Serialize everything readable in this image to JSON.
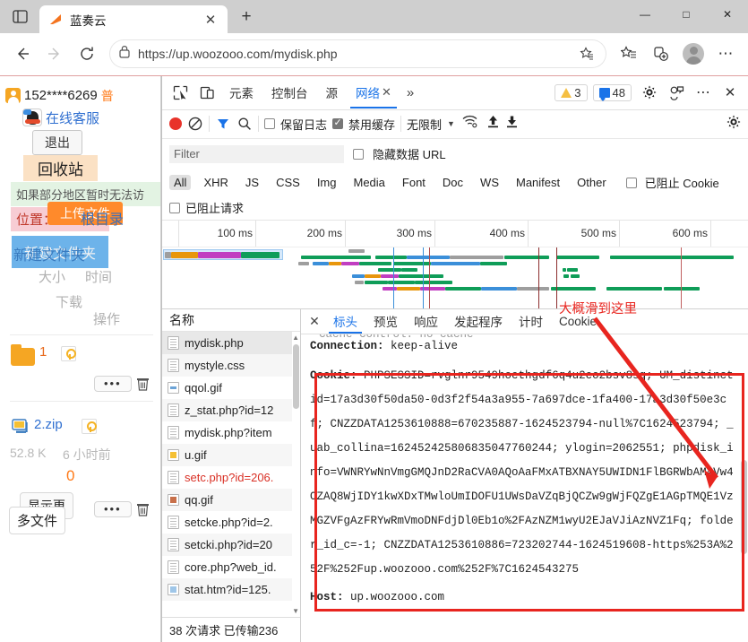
{
  "browser": {
    "tab": {
      "title": "蓝奏云",
      "close_label": "✕"
    },
    "newtab_label": "+",
    "window": {
      "minimize": "—",
      "maximize": "□",
      "close": "✕"
    },
    "nav": {
      "back": "←",
      "forward": "→",
      "reload": "⟳",
      "lock_icon": "lock-icon",
      "url": "https://up.woozooo.com/mydisk.php",
      "favorite": "☆",
      "collections": "collections-icon",
      "profile": "profile-icon",
      "settings_more": "⋯"
    }
  },
  "page": {
    "user": "152****6269",
    "user_tag": "普",
    "service_link": "在线客服",
    "logout": "退出",
    "recycle": "回收站",
    "notice": "如果部分地区暂时无法访",
    "upload": "上传文件",
    "location_label": "位置：",
    "location_value": "根目录",
    "new_folder": "新建文件夹",
    "col_size": "大小",
    "col_time": "时间",
    "col_download": "下载",
    "col_action": "操作",
    "rows": [
      {
        "name": "1",
        "type": "folder",
        "locked": true,
        "more": "•••",
        "delete": "trash-icon"
      },
      {
        "name": "2.zip",
        "type": "file",
        "locked": true,
        "size": "52.8 K",
        "time": "6 小时前",
        "downloads": "0",
        "more": "•••",
        "delete": "trash-icon"
      }
    ],
    "show_more": "显示更",
    "show_more2": "多文件"
  },
  "devtools": {
    "toolbar": {
      "inspect_icon": "inspect-icon",
      "device_icon": "device-toggle-icon",
      "tabs": [
        {
          "label": "元素",
          "active": false
        },
        {
          "label": "控制台",
          "active": false
        },
        {
          "label": "源",
          "active": false
        },
        {
          "label": "网络",
          "active": true,
          "closable": "✕"
        }
      ],
      "more_tabs": "»",
      "warnings": "3",
      "messages": "48",
      "settings_icon": "gear-icon",
      "feedback_icon": "feedback-icon",
      "more_icon": "⋯",
      "close_icon": "✕"
    },
    "controls": {
      "record": "record-icon",
      "clear": "clear-icon",
      "filter": "filter-icon",
      "search": "search-icon",
      "preserve_log": "保留日志",
      "preserve_log_checked": false,
      "disable_cache": "禁用缓存",
      "disable_cache_checked": true,
      "throttle": "无限制",
      "caret": "▼",
      "wifi_icon": "wifi-icon",
      "upload_icon": "upload-icon",
      "download_icon": "download-icon",
      "settings_icon": "gear-icon"
    },
    "filter": {
      "placeholder": "Filter",
      "hide_data_urls": "隐藏数据 URL",
      "hide_data_urls_checked": false,
      "types": [
        "All",
        "XHR",
        "JS",
        "CSS",
        "Img",
        "Media",
        "Font",
        "Doc",
        "WS",
        "Manifest",
        "Other"
      ],
      "active_type": "All",
      "blocked_cookies": "已阻止 Cookie",
      "blocked_cookies_checked": false,
      "blocked_requests": "已阻止请求",
      "blocked_requests_checked": false
    },
    "timeline": {
      "ticks": [
        "100 ms",
        "200 ms",
        "300 ms",
        "400 ms",
        "500 ms",
        "600 ms"
      ]
    },
    "requests": {
      "column_name": "名称",
      "items": [
        {
          "name": "mydisk.php",
          "icon": "document-icon",
          "selected": true,
          "error": false
        },
        {
          "name": "mystyle.css",
          "icon": "document-icon",
          "selected": false,
          "error": false
        },
        {
          "name": "qqol.gif",
          "icon": "image-icon",
          "selected": false,
          "error": false
        },
        {
          "name": "z_stat.php?id=12",
          "icon": "document-icon",
          "selected": false,
          "error": false
        },
        {
          "name": "mydisk.php?item",
          "icon": "document-icon",
          "selected": false,
          "error": false
        },
        {
          "name": "u.gif",
          "icon": "image-icon",
          "selected": false,
          "error": false
        },
        {
          "name": "setc.php?id=206.",
          "icon": "document-icon",
          "selected": false,
          "error": true
        },
        {
          "name": "qq.gif",
          "icon": "image-icon",
          "selected": false,
          "error": false
        },
        {
          "name": "setcke.php?id=2.",
          "icon": "document-icon",
          "selected": false,
          "error": false
        },
        {
          "name": "setcki.php?id=20",
          "icon": "document-icon",
          "selected": false,
          "error": false
        },
        {
          "name": "core.php?web_id.",
          "icon": "document-icon",
          "selected": false,
          "error": false
        },
        {
          "name": "stat.htm?id=125.",
          "icon": "image-icon",
          "selected": false,
          "error": false
        }
      ],
      "status": "38 次请求  已传输236"
    },
    "detail": {
      "close": "✕",
      "tabs": [
        {
          "label": "标头",
          "active": true
        },
        {
          "label": "预览",
          "active": false
        },
        {
          "label": "响应",
          "active": false
        },
        {
          "label": "发起程序",
          "active": false
        },
        {
          "label": "计时",
          "active": false
        },
        {
          "label": "Cookie",
          "active": false
        }
      ],
      "headers": {
        "cut_line": "Cache-Control: no-cache",
        "connection_key": "Connection:",
        "connection_value": "keep-alive",
        "cookie_key": "Cookie:",
        "cookie_value": "PHPSESSID=rvglnr9549hoethgdf6q4u2eo2bsv8sq; UM_distinctid=17a3d30f50da50-0d3f2f54a3a955-7a697dce-1fa400-17a3d30f50e3cf; CNZZDATA1253610888=670235887-1624523794-null%7C1624523794; _uab_collina=162452425806835047760244; ylogin=2062551; phpdisk_info=VWNRYwNnVmgGMQJnD2RaCVA0AQoAaFMxATBXNAY5UWIDN1FlBGRWbAM4Vw4OZAQ8WjIDY1kwXDxTMwloUmIDOFU1UWsDaVZqBjQCZw9gWjFQZgE1AGpTMQE1VzMGZVFgAzFRYwRmVmoDNFdjDl0Eb1o%2FAzNZM1wyU2EJaVJiAzNVZ1Fq; folder_id_c=-1; CNZZDATA1253610886=723202744-1624519608-https%253A%252F%252Fup.woozooo.com%252F%7C1624543275",
        "host_key": "Host:",
        "host_value": "up.woozooo.com"
      }
    }
  },
  "annotation": {
    "text": "大概滑到这里",
    "color": "#e8251f"
  }
}
